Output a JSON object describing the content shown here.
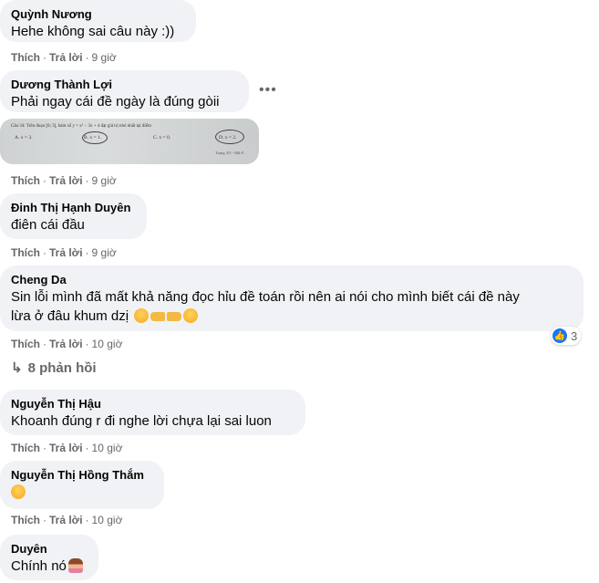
{
  "comments": [
    {
      "name": "Quỳnh Nương",
      "text": "Hehe không sai câu này :))",
      "like": "Thích",
      "reply": "Trả lời",
      "time": "9 giờ"
    },
    {
      "name": "Dương Thành Lợi",
      "text": "Phải ngay cái đề ngày là đúng gòii",
      "like": "Thích",
      "reply": "Trả lời",
      "time": "9 giờ",
      "more": "•••",
      "photo_text": {
        "line1": "Câu 34: Trên đoạn [0; 3], hàm số y = x³ − 3x + 4 đạt giá trị nhỏ nhất tại điểm",
        "a": "A. x = 3.",
        "b": "B. x = 1.",
        "c": "C. x = 0.",
        "d": "D. x = 2.",
        "footer": "Trang 3/5 - Mã đ"
      }
    },
    {
      "name": "Đinh Thị Hạnh Duyên",
      "text": "điên cái đầu",
      "like": "Thích",
      "reply": "Trả lời",
      "time": "9 giờ"
    },
    {
      "name": "Cheng Da",
      "text": "Sin lỗi mình đã mất khả năng đọc hỉu đề toán rồi nên ai nói cho mình biết cái đề này",
      "text2": "lừa ở đâu khum dzị",
      "like": "Thích",
      "reply": "Trả lời",
      "time": "10 giờ",
      "reaction_count": "3"
    },
    {
      "name": "Nguyễn Thị Hậu",
      "text": "Khoanh đúng r đi nghe lời chựa lại sai luon",
      "like": "Thích",
      "reply": "Trả lời",
      "time": "10 giờ"
    },
    {
      "name": "Nguyễn Thị Hồng Thắm",
      "text": "",
      "like": "Thích",
      "reply": "Trả lời",
      "time": "10 giờ"
    },
    {
      "name": "Duyên",
      "text": "Chính nó",
      "like": "Thích",
      "reply": "Trả lời",
      "time": ""
    }
  ],
  "replies_link": "8 phản hồi",
  "dot": "·",
  "colors": {
    "bubble": "#f0f2f5",
    "meta": "#65676b",
    "like": "#1877f2"
  }
}
